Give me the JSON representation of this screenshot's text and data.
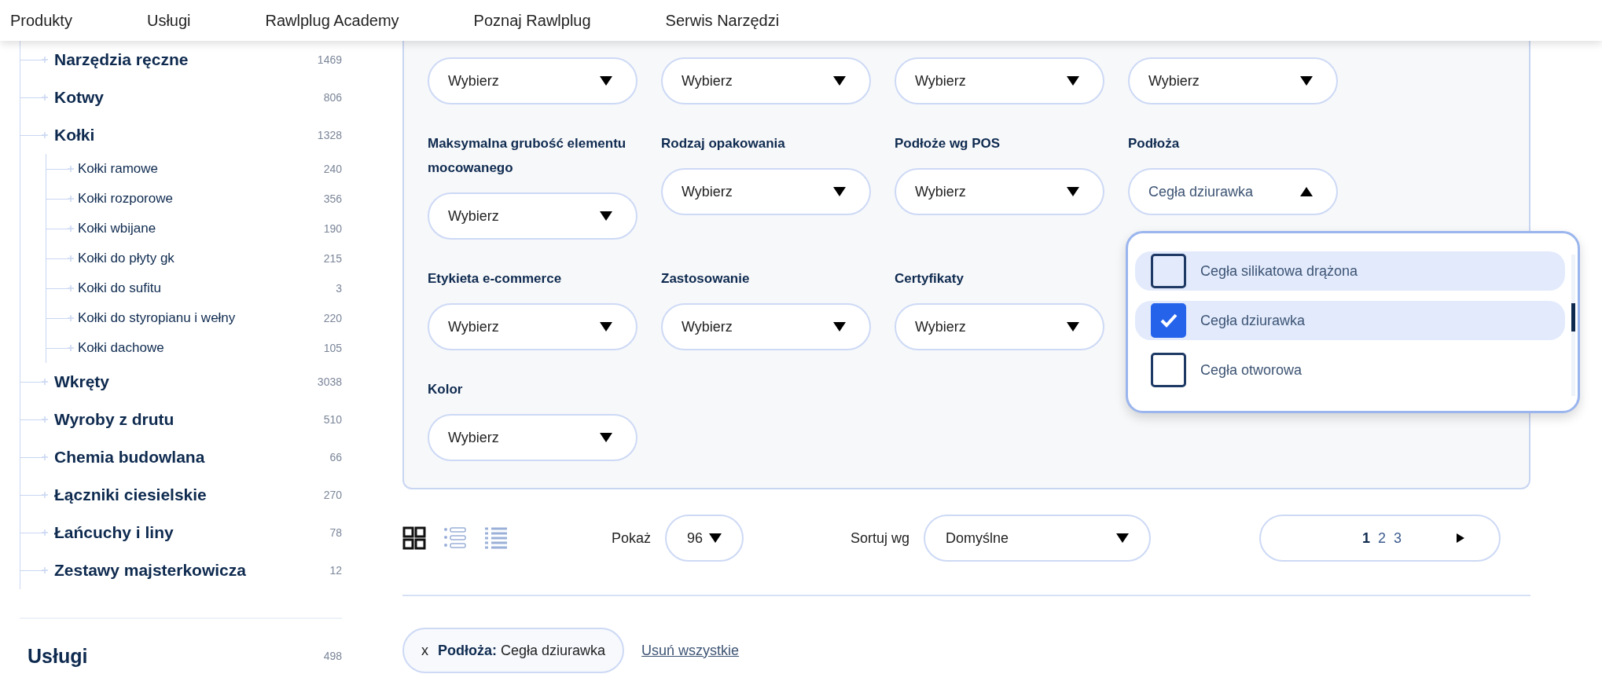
{
  "nav": [
    {
      "label": "Produkty"
    },
    {
      "label": "Usługi"
    },
    {
      "label": "Rawlplug Academy"
    },
    {
      "label": "Poznaj Rawlplug"
    },
    {
      "label": "Serwis Narzędzi"
    }
  ],
  "sidebar": {
    "categories": [
      {
        "label": "Narzędzia ręczne",
        "count": "1469"
      },
      {
        "label": "Kotwy",
        "count": "806"
      },
      {
        "label": "Kołki",
        "count": "1328",
        "children": [
          {
            "label": "Kołki ramowe",
            "count": "240"
          },
          {
            "label": "Kołki rozporowe",
            "count": "356"
          },
          {
            "label": "Kołki wbijane",
            "count": "190"
          },
          {
            "label": "Kołki do płyty gk",
            "count": "215"
          },
          {
            "label": "Kołki do sufitu",
            "count": "3"
          },
          {
            "label": "Kołki do styropianu i wełny",
            "count": "220"
          },
          {
            "label": "Kołki dachowe",
            "count": "105"
          }
        ]
      },
      {
        "label": "Wkręty",
        "count": "3038"
      },
      {
        "label": "Wyroby z drutu",
        "count": "510"
      },
      {
        "label": "Chemia budowlana",
        "count": "66"
      },
      {
        "label": "Łączniki ciesielskie",
        "count": "270"
      },
      {
        "label": "Łańcuchy i liny",
        "count": "78"
      },
      {
        "label": "Zestawy majsterkowicza",
        "count": "12"
      }
    ],
    "section": {
      "label": "Usługi",
      "count": "498"
    }
  },
  "filter_rows": [
    [
      {
        "value": "Wybierz",
        "open": false
      },
      {
        "value": "Wybierz",
        "open": false
      },
      {
        "value": "Wybierz",
        "open": false
      },
      {
        "value": "Wybierz",
        "open": false
      }
    ],
    [
      {
        "label": "Maksymalna grubość elementu mocowanego",
        "value": "Wybierz",
        "open": false
      },
      {
        "label": "Rodzaj opakowania",
        "value": "Wybierz",
        "open": false
      },
      {
        "label": "Podłoże wg POS",
        "value": "Wybierz",
        "open": false
      },
      {
        "label": "Podłoża",
        "value": "Cegła dziurawka",
        "open": true,
        "options": [
          {
            "label": "Cegła silikatowa drążona",
            "checked": false,
            "highlighted": true
          },
          {
            "label": "Cegła dziurawka",
            "checked": true,
            "highlighted": true
          },
          {
            "label": "Cegła otworowa",
            "checked": false,
            "highlighted": false
          }
        ]
      }
    ],
    [
      {
        "label": "Etykieta e-commerce",
        "value": "Wybierz",
        "open": false
      },
      {
        "label": "Zastosowanie",
        "value": "Wybierz",
        "open": false
      },
      {
        "label": "Certyfikaty",
        "value": "Wybierz",
        "open": false
      }
    ],
    [
      {
        "label": "Kolor",
        "value": "Wybierz",
        "open": false
      }
    ]
  ],
  "toolbar": {
    "view_modes": [
      {
        "kind": "grid",
        "selected": true
      },
      {
        "kind": "cards",
        "selected": false
      },
      {
        "kind": "list",
        "selected": false
      }
    ],
    "show_label": "Pokaż",
    "show_value": "96",
    "sort_label": "Sortuj wg",
    "sort_value": "Domyślne",
    "pages": [
      {
        "label": "1",
        "selected": true
      },
      {
        "label": "2",
        "selected": false
      },
      {
        "label": "3",
        "selected": false
      }
    ]
  },
  "active_filters": [
    {
      "remove": "x",
      "text": "**Podłoża:** Cegła dziurawka"
    }
  ],
  "clear_all": "Usuń wszystkie"
}
